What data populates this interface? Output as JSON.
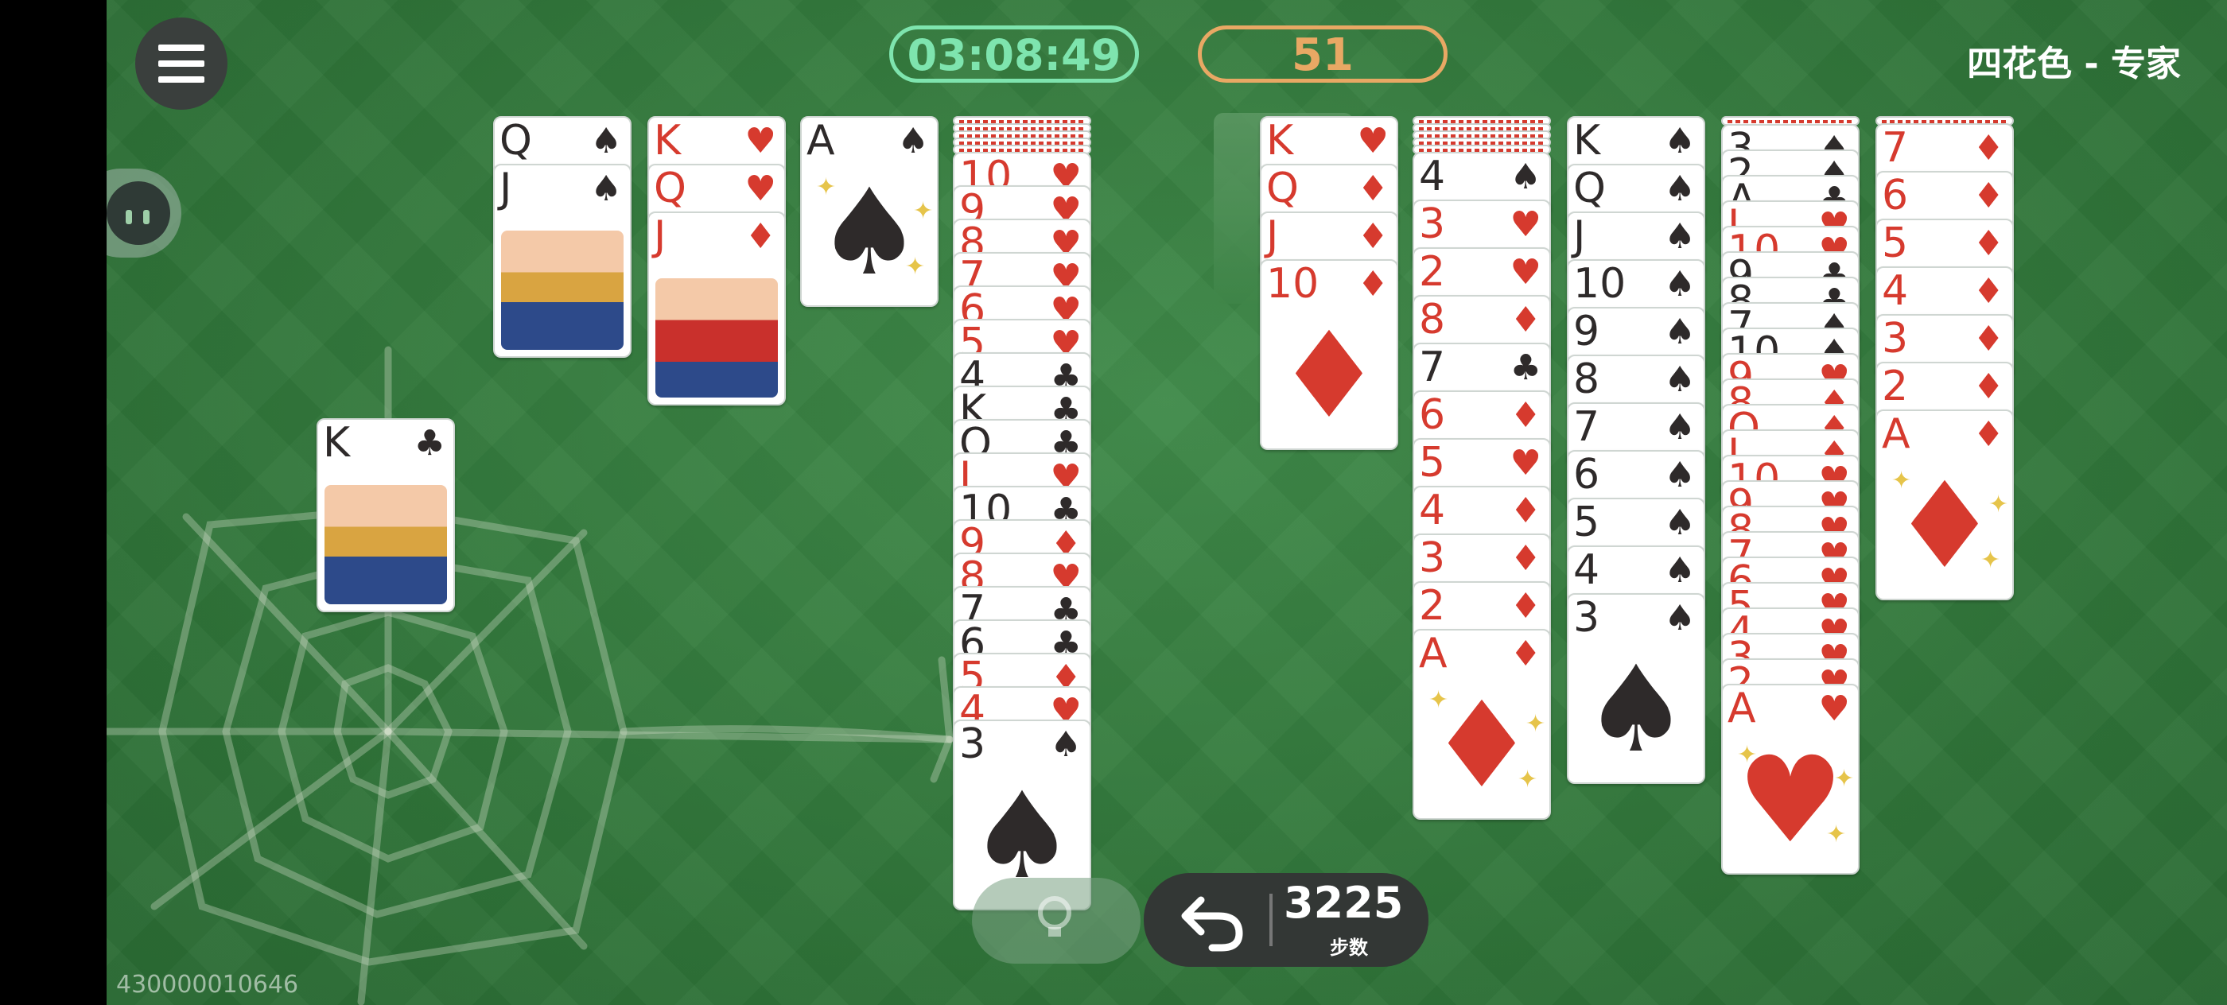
{
  "header": {
    "timer": "03:08:49",
    "score": "51",
    "mode": "四花色 - 专家"
  },
  "footer": {
    "seed": "430000010646",
    "moves_count": "3225",
    "moves_label": "步数"
  },
  "colors": {
    "felt": "#2f7338",
    "timer": "#7ee4ae",
    "score": "#e8a864",
    "red_suit": "#d63a2e",
    "black_suit": "#2e2a2a"
  },
  "icons": {
    "menu": "hamburger-menu-icon",
    "undo": "undo-arrow-icon",
    "hint": "lightbulb-icon",
    "avatar": "avatar-icon",
    "web": "spider-web-decoration"
  },
  "completed": {
    "card": {
      "rank": "K",
      "suit": "♣",
      "color": "black"
    }
  },
  "columns": [
    {
      "hidden": 0,
      "cards": [
        {
          "rank": "Q",
          "suit": "♠",
          "color": "black"
        },
        {
          "rank": "J",
          "suit": "♠",
          "color": "black"
        }
      ]
    },
    {
      "hidden": 0,
      "cards": [
        {
          "rank": "K",
          "suit": "♥",
          "color": "red"
        },
        {
          "rank": "Q",
          "suit": "♥",
          "color": "red"
        },
        {
          "rank": "J",
          "suit": "♦",
          "color": "red"
        }
      ]
    },
    {
      "hidden": 0,
      "cards": [
        {
          "rank": "A",
          "suit": "♠",
          "color": "black"
        }
      ]
    },
    {
      "hidden": 5,
      "cards": [
        {
          "rank": "10",
          "suit": "♥",
          "color": "red"
        },
        {
          "rank": "9",
          "suit": "♥",
          "color": "red"
        },
        {
          "rank": "8",
          "suit": "♥",
          "color": "red"
        },
        {
          "rank": "7",
          "suit": "♥",
          "color": "red"
        },
        {
          "rank": "6",
          "suit": "♥",
          "color": "red"
        },
        {
          "rank": "5",
          "suit": "♥",
          "color": "red"
        },
        {
          "rank": "4",
          "suit": "♣",
          "color": "black"
        },
        {
          "rank": "K",
          "suit": "♣",
          "color": "black"
        },
        {
          "rank": "Q",
          "suit": "♣",
          "color": "black"
        },
        {
          "rank": "J",
          "suit": "♥",
          "color": "red"
        },
        {
          "rank": "10",
          "suit": "♣",
          "color": "black"
        },
        {
          "rank": "9",
          "suit": "♦",
          "color": "red"
        },
        {
          "rank": "8",
          "suit": "♥",
          "color": "red"
        },
        {
          "rank": "7",
          "suit": "♣",
          "color": "black"
        },
        {
          "rank": "6",
          "suit": "♣",
          "color": "black"
        },
        {
          "rank": "5",
          "suit": "♦",
          "color": "red"
        },
        {
          "rank": "4",
          "suit": "♥",
          "color": "red"
        },
        {
          "rank": "3",
          "suit": "♠",
          "color": "black"
        }
      ]
    },
    {
      "hidden": 0,
      "empty": true,
      "cards": []
    },
    {
      "hidden": 0,
      "cards": [
        {
          "rank": "K",
          "suit": "♥",
          "color": "red"
        },
        {
          "rank": "Q",
          "suit": "♦",
          "color": "red"
        },
        {
          "rank": "J",
          "suit": "♦",
          "color": "red"
        },
        {
          "rank": "10",
          "suit": "♦",
          "color": "red"
        }
      ]
    },
    {
      "hidden": 5,
      "cards": [
        {
          "rank": "4",
          "suit": "♠",
          "color": "black"
        },
        {
          "rank": "3",
          "suit": "♥",
          "color": "red"
        },
        {
          "rank": "2",
          "suit": "♥",
          "color": "red"
        },
        {
          "rank": "8",
          "suit": "♦",
          "color": "red"
        },
        {
          "rank": "7",
          "suit": "♣",
          "color": "black"
        },
        {
          "rank": "6",
          "suit": "♦",
          "color": "red"
        },
        {
          "rank": "5",
          "suit": "♥",
          "color": "red"
        },
        {
          "rank": "4",
          "suit": "♦",
          "color": "red"
        },
        {
          "rank": "3",
          "suit": "♦",
          "color": "red"
        },
        {
          "rank": "2",
          "suit": "♦",
          "color": "red"
        },
        {
          "rank": "A",
          "suit": "♦",
          "color": "red"
        }
      ]
    },
    {
      "hidden": 0,
      "cards": [
        {
          "rank": "K",
          "suit": "♠",
          "color": "black"
        },
        {
          "rank": "Q",
          "suit": "♠",
          "color": "black"
        },
        {
          "rank": "J",
          "suit": "♠",
          "color": "black"
        },
        {
          "rank": "10",
          "suit": "♠",
          "color": "black"
        },
        {
          "rank": "9",
          "suit": "♠",
          "color": "black"
        },
        {
          "rank": "8",
          "suit": "♠",
          "color": "black"
        },
        {
          "rank": "7",
          "suit": "♠",
          "color": "black"
        },
        {
          "rank": "6",
          "suit": "♠",
          "color": "black"
        },
        {
          "rank": "5",
          "suit": "♠",
          "color": "black"
        },
        {
          "rank": "4",
          "suit": "♠",
          "color": "black"
        },
        {
          "rank": "3",
          "suit": "♠",
          "color": "black"
        }
      ]
    },
    {
      "hidden": 1,
      "cards": [
        {
          "rank": "3",
          "suit": "♠",
          "color": "black"
        },
        {
          "rank": "2",
          "suit": "♠",
          "color": "black"
        },
        {
          "rank": "A",
          "suit": "♣",
          "color": "black"
        },
        {
          "rank": "J",
          "suit": "♥",
          "color": "red"
        },
        {
          "rank": "10",
          "suit": "♥",
          "color": "red"
        },
        {
          "rank": "9",
          "suit": "♣",
          "color": "black"
        },
        {
          "rank": "8",
          "suit": "♣",
          "color": "black"
        },
        {
          "rank": "7",
          "suit": "♠",
          "color": "black"
        },
        {
          "rank": "10",
          "suit": "♠",
          "color": "black"
        },
        {
          "rank": "9",
          "suit": "♥",
          "color": "red"
        },
        {
          "rank": "8",
          "suit": "♦",
          "color": "red"
        },
        {
          "rank": "Q",
          "suit": "♦",
          "color": "red"
        },
        {
          "rank": "J",
          "suit": "♦",
          "color": "red"
        },
        {
          "rank": "10",
          "suit": "♥",
          "color": "red"
        },
        {
          "rank": "9",
          "suit": "♥",
          "color": "red"
        },
        {
          "rank": "8",
          "suit": "♥",
          "color": "red"
        },
        {
          "rank": "7",
          "suit": "♥",
          "color": "red"
        },
        {
          "rank": "6",
          "suit": "♥",
          "color": "red"
        },
        {
          "rank": "5",
          "suit": "♥",
          "color": "red"
        },
        {
          "rank": "4",
          "suit": "♥",
          "color": "red"
        },
        {
          "rank": "3",
          "suit": "♥",
          "color": "red"
        },
        {
          "rank": "2",
          "suit": "♥",
          "color": "red"
        },
        {
          "rank": "A",
          "suit": "♥",
          "color": "red"
        }
      ]
    },
    {
      "hidden": 1,
      "cards": [
        {
          "rank": "7",
          "suit": "♦",
          "color": "red"
        },
        {
          "rank": "6",
          "suit": "♦",
          "color": "red"
        },
        {
          "rank": "5",
          "suit": "♦",
          "color": "red"
        },
        {
          "rank": "4",
          "suit": "♦",
          "color": "red"
        },
        {
          "rank": "3",
          "suit": "♦",
          "color": "red"
        },
        {
          "rank": "2",
          "suit": "♦",
          "color": "red"
        },
        {
          "rank": "A",
          "suit": "♦",
          "color": "red"
        }
      ]
    }
  ]
}
